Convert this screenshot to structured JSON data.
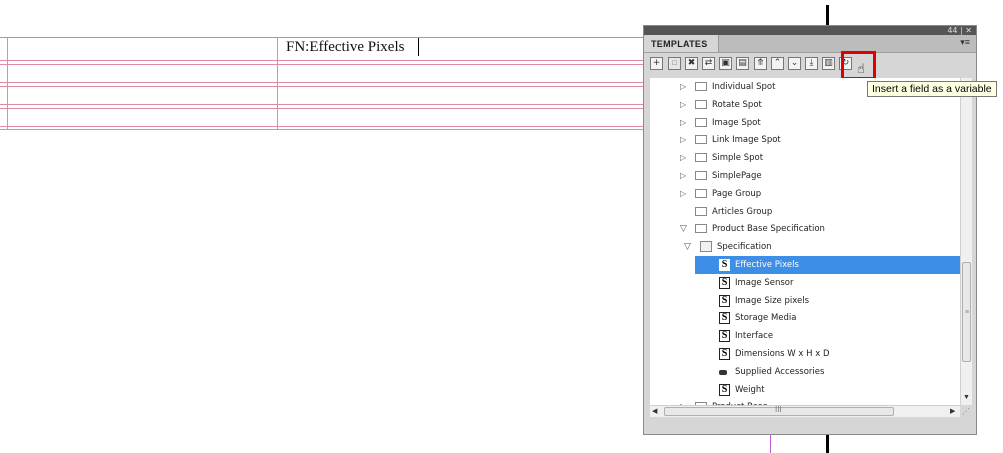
{
  "document": {
    "cell_text": "FN:Effective Pixels"
  },
  "panel": {
    "window_controls": "44 | ✕",
    "tab_label": "TEMPLATES",
    "menu_icon": "▾≡",
    "toolbar": [
      {
        "name": "new-template-icon",
        "glyph": "+"
      },
      {
        "name": "duplicate-icon",
        "glyph": "▫"
      },
      {
        "name": "delete-icon",
        "glyph": "✖"
      },
      {
        "name": "move-icon",
        "glyph": "⇄"
      },
      {
        "name": "copy-icon",
        "glyph": "▣"
      },
      {
        "name": "properties-icon",
        "glyph": "▤"
      },
      {
        "name": "collapse-all-icon",
        "glyph": "⤊"
      },
      {
        "name": "move-up-icon",
        "glyph": "⌃"
      },
      {
        "name": "move-down-icon",
        "glyph": "⌄"
      },
      {
        "name": "insert-field-icon",
        "glyph": "⤓"
      },
      {
        "name": "insert-field-as-variable-icon",
        "glyph": "▥"
      },
      {
        "name": "refresh-icon",
        "glyph": "↻"
      }
    ],
    "tooltip": "Insert a field as a variable",
    "tree": [
      {
        "label": "Individual Spot",
        "icon": "box",
        "expander": "closed"
      },
      {
        "label": "Rotate Spot",
        "icon": "box",
        "expander": "closed"
      },
      {
        "label": "Image Spot",
        "icon": "box",
        "expander": "closed"
      },
      {
        "label": "Link Image Spot",
        "icon": "box",
        "expander": "closed"
      },
      {
        "label": "Simple Spot",
        "icon": "box",
        "expander": "closed"
      },
      {
        "label": "SimplePage",
        "icon": "box",
        "expander": "closed"
      },
      {
        "label": "Page Group",
        "icon": "box",
        "expander": "closed"
      },
      {
        "label": "Articles Group",
        "icon": "box",
        "expander": "none"
      },
      {
        "label": "Product Base Specification",
        "icon": "box",
        "expander": "open"
      },
      {
        "label": "Specification",
        "icon": "folder",
        "expander": "open"
      },
      {
        "label": "Effective Pixels",
        "icon": "S",
        "expander": "none",
        "selected": true
      },
      {
        "label": "Image Sensor",
        "icon": "S",
        "expander": "none"
      },
      {
        "label": "Image Size pixels",
        "icon": "S",
        "expander": "none"
      },
      {
        "label": "Storage Media",
        "icon": "S",
        "expander": "none"
      },
      {
        "label": "Interface",
        "icon": "S",
        "expander": "none"
      },
      {
        "label": "Dimensions W x H x D",
        "icon": "S",
        "expander": "none"
      },
      {
        "label": "Supplied Accessories",
        "icon": "pill",
        "expander": "none"
      },
      {
        "label": "Weight",
        "icon": "S",
        "expander": "none"
      },
      {
        "label": "Product Base",
        "icon": "box",
        "expander": "closed"
      }
    ],
    "hscroll_grip": "III",
    "vscroll_grip": "≡",
    "resize_grip": "⋰"
  }
}
